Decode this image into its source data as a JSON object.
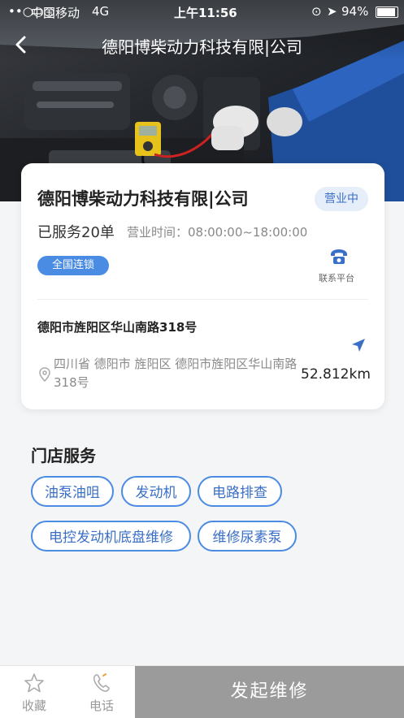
{
  "status_bar": {
    "carrier": "中国移动",
    "network": "4G",
    "time": "上午11:56",
    "battery": "94%"
  },
  "nav": {
    "title": "德阳博柴动力科技有限|公司"
  },
  "shop": {
    "name": "德阳博柴动力科技有限|公司",
    "status": "营业中",
    "served": "已服务20单",
    "hours": "营业时间：08:00:00~18:00:00",
    "tag": "全国连锁",
    "contact_label": "联系平台",
    "address_title": "德阳市旌阳区华山南路318号",
    "address_detail": "四川省 德阳市 旌阳区 德阳市旌阳区华山南路318号",
    "distance": "52.812km"
  },
  "services": {
    "heading": "门店服务",
    "items": [
      "油泵油咀",
      "发动机",
      "电路排查",
      "电控发动机底盘维修",
      "维修尿素泵"
    ]
  },
  "bottom": {
    "favorite": "收藏",
    "phone": "电话",
    "start_repair": "发起维修"
  },
  "colors": {
    "accent": "#4a8be3",
    "button_disabled": "#9b9b9b"
  }
}
